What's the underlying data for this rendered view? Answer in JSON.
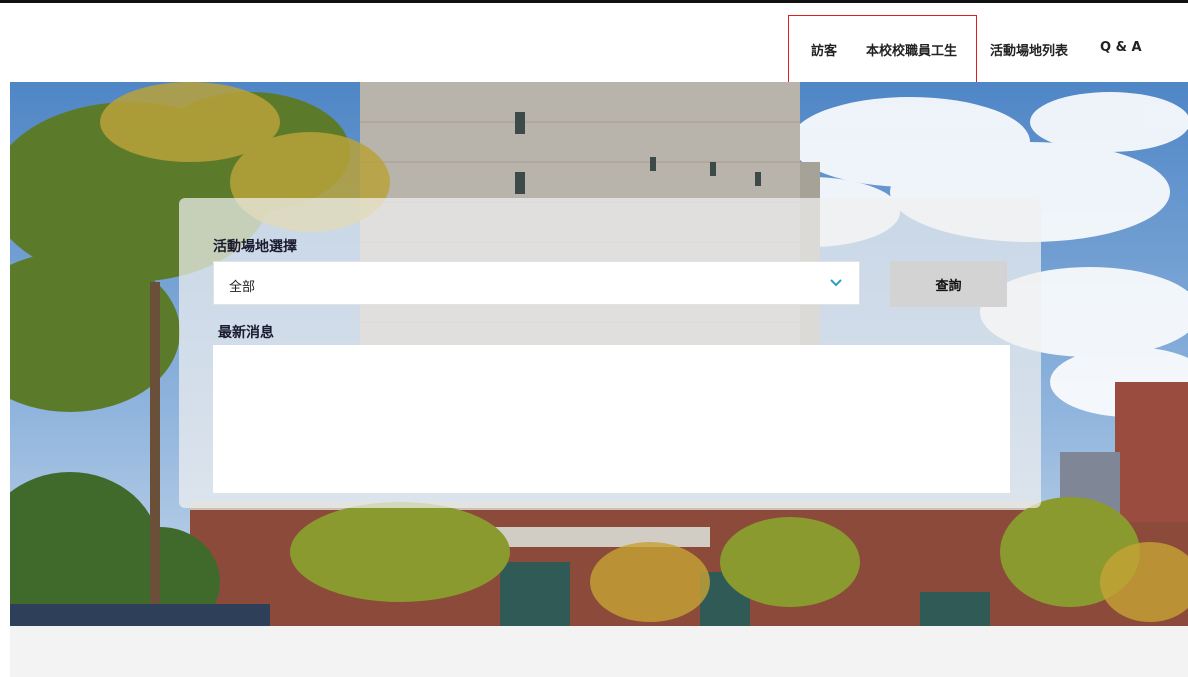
{
  "nav": {
    "items": [
      {
        "label": "訪客"
      },
      {
        "label": "本校校職員工生"
      },
      {
        "label": "活動場地列表"
      },
      {
        "label": "Q & A"
      }
    ],
    "highlight_color": "#e02020"
  },
  "search": {
    "venue_label": "活動場地選擇",
    "venue_selected": "全部",
    "query_button": "查詢",
    "news_label": "最新消息",
    "news_content": ""
  },
  "colors": {
    "panel_bg": "#f0f0f0",
    "button_bg": "#d3d3d3",
    "chevron": "#2a9fbf",
    "footer_bg": "#f3f3f3"
  }
}
